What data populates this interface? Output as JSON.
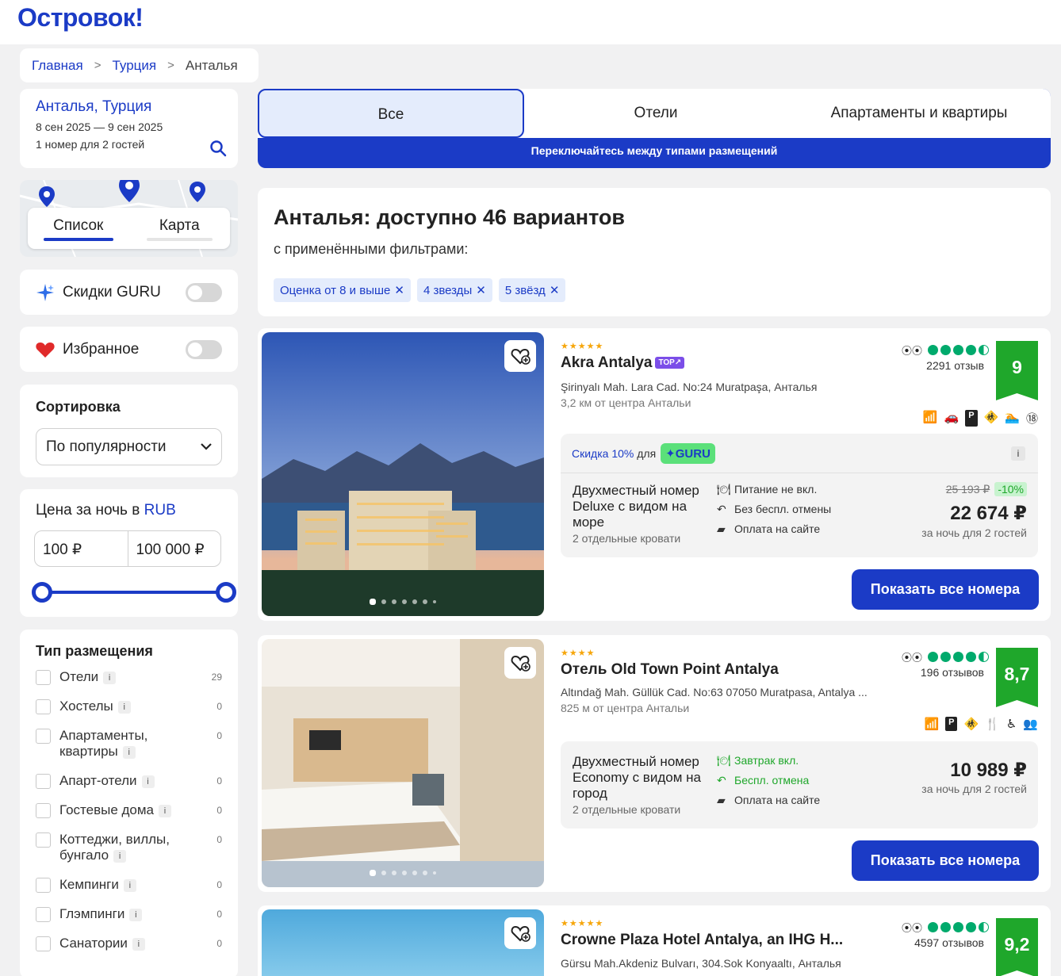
{
  "brand": {
    "logo": "Островок!"
  },
  "breadcrumb": {
    "home": "Главная",
    "country": "Турция",
    "city": "Анталья"
  },
  "search": {
    "destination": "Анталья, Турция",
    "dates": "8 сен 2025 — 9 сен 2025",
    "guests": "1 номер для 2 гостей",
    "icon": "search-icon"
  },
  "view": {
    "list": "Список",
    "map": "Карта"
  },
  "guru": {
    "label": "Скидки GURU",
    "icon": "sparkle-icon"
  },
  "favorites": {
    "label": "Избранное",
    "icon": "heart-icon"
  },
  "sort": {
    "title": "Сортировка",
    "value": "По популярности"
  },
  "price": {
    "title_prefix": "Цена за ночь в",
    "currency": "RUB",
    "min": "100 ₽",
    "max": "100 000 ₽"
  },
  "types": {
    "title": "Тип размещения",
    "items": [
      {
        "label": "Отели",
        "count": "29"
      },
      {
        "label": "Хостелы",
        "count": "0"
      },
      {
        "label": "Апартаменты, квартиры",
        "count": "0"
      },
      {
        "label": "Апарт-отели",
        "count": "0"
      },
      {
        "label": "Гостевые дома",
        "count": "0"
      },
      {
        "label": "Коттеджи, виллы, бунгало",
        "count": "0"
      },
      {
        "label": "Кемпинги",
        "count": "0"
      },
      {
        "label": "Глэмпинги",
        "count": "0"
      },
      {
        "label": "Санатории",
        "count": "0"
      }
    ]
  },
  "tabs": {
    "all": "Все",
    "hotels": "Отели",
    "apartments": "Апартаменты и квартиры",
    "note": "Переключайтесь между типами размещений"
  },
  "results": {
    "title": "Анталья: доступно 46 вариантов",
    "subtitle": "с применёнными фильтрами:",
    "chips": [
      "Оценка от 8 и выше",
      "4 звезды",
      "5 звёзд"
    ]
  },
  "hotels": [
    {
      "stars": "★★★★★",
      "name": "Akra Antalya",
      "badge": "TOP↗",
      "address": "Şirinyalı Mah. Lara Cad. No:24 Muratpaşa, Анталья",
      "distance": "3,2 км от центра Антальи",
      "reviews": "2291 отзыв",
      "score": "9",
      "guru": {
        "discount": "Скидка 10%",
        "for": "для",
        "badge": "GURU"
      },
      "room": "Двухместный номер Deluxe с видом на море",
      "beds": "2 отдельные кровати",
      "feats": [
        "Питание не вкл.",
        "Без беспл. отмены",
        "Оплата на сайте"
      ],
      "old_price": "25 193 ₽",
      "discount_pct": "-10%",
      "price": "22 674 ₽",
      "per": "за ночь для 2 гостей",
      "button": "Показать все номера"
    },
    {
      "stars": "★★★★",
      "name": "Отель Old Town Point Antalya",
      "address": "Altındağ Mah. Güllük Cad. No:63 07050 Muratpasa, Antalya ...",
      "distance": "825 м от центра Антальи",
      "reviews": "196 отзывов",
      "score": "8,7",
      "room": "Двухместный номер Economy с видом на город",
      "beds": "2 отдельные кровати",
      "feats": [
        "Завтрак вкл.",
        "Беспл. отмена",
        "Оплата на сайте"
      ],
      "price": "10 989 ₽",
      "per": "за ночь для 2 гостей",
      "button": "Показать все номера"
    },
    {
      "stars": "★★★★★",
      "name": "Crowne Plaza Hotel Antalya, an IHG H...",
      "address": "Gürsu Mah.Akdeniz Bulvarı, 304.Sok Konyaaltı, Анталья",
      "reviews": "4597 отзывов",
      "score": "9,2"
    }
  ],
  "colors": {
    "brand": "#1b3bc6",
    "score": "#1fa72b",
    "guru": "#5be07a",
    "tripadvisor": "#00aa6c"
  }
}
